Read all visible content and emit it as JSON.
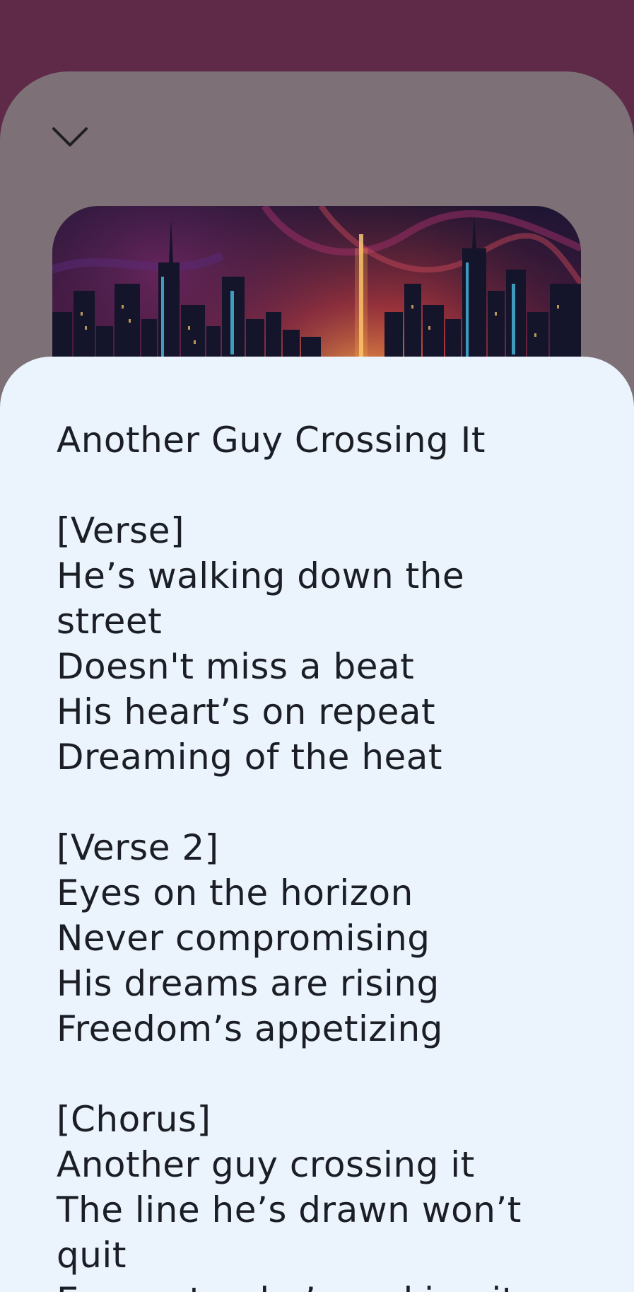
{
  "player": {
    "collapse_icon": "chevron-down-icon",
    "artwork_icon": "city-skyline-artwork"
  },
  "lyrics": {
    "text": "Another Guy Crossing It\n\n[Verse]\nHe’s walking down the street\nDoesn't miss a beat\nHis heart’s on repeat\nDreaming of the heat\n\n[Verse 2]\nEyes on the horizon\nNever compromising\nHis dreams are rising\nFreedom’s appetizing\n\n[Chorus]\nAnother guy crossing it\nThe line he’s drawn won’t quit\nEvery step he’s making it"
  },
  "colors": {
    "top_background": "#5e2a48",
    "player_background": "#7d7177",
    "lyrics_background": "#ebf3fd",
    "lyrics_text": "#1b1e24"
  }
}
